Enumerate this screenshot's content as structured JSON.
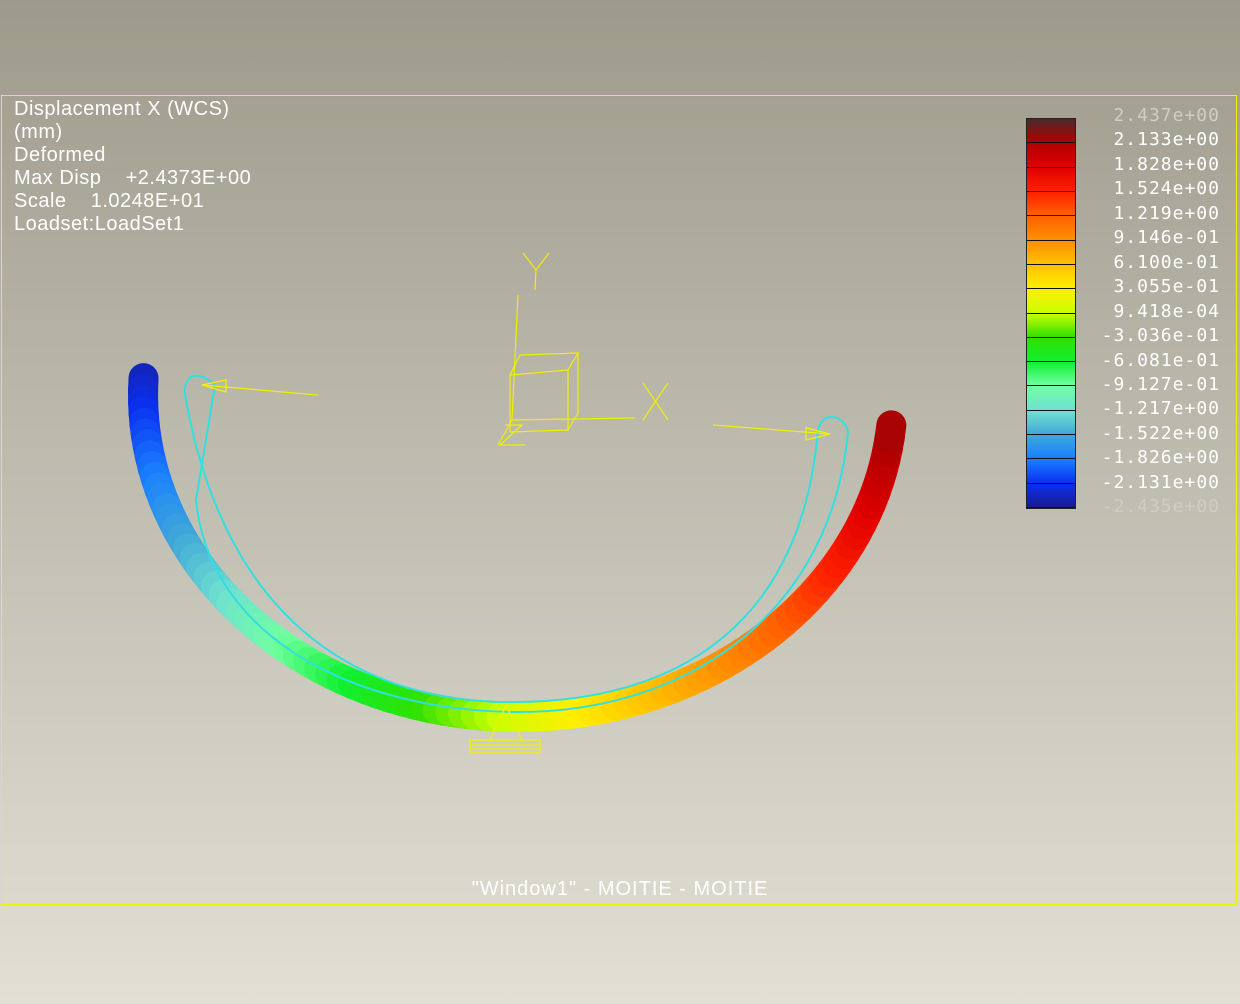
{
  "info": {
    "title": "Displacement X (WCS)",
    "units": "(mm)",
    "mode": "Deformed",
    "max_disp": "Max Disp    +2.4373E+00",
    "scale": "Scale    1.0248E+01",
    "loadset": "Loadset:LoadSet1"
  },
  "legend": {
    "labels": [
      "2.437e+00",
      "2.133e+00",
      "1.828e+00",
      "1.524e+00",
      "1.219e+00",
      "9.146e-01",
      "6.100e-01",
      "3.055e-01",
      "9.418e-04",
      "-3.036e-01",
      "-6.081e-01",
      "-9.127e-01",
      "-1.217e+00",
      "-1.522e+00",
      "-1.826e+00",
      "-2.131e+00",
      "-2.435e+00"
    ],
    "colors": [
      "#4a2a2a",
      "#b00000",
      "#e00000",
      "#ff2000",
      "#ff6000",
      "#ff9000",
      "#ffc000",
      "#ffee00",
      "#c8ff00",
      "#30e000",
      "#10f030",
      "#70ffa0",
      "#70e0d0",
      "#40a8d8",
      "#1a80ff",
      "#0a30f0",
      "#1a1a90"
    ]
  },
  "axes": {
    "x": "X",
    "y": "Y"
  },
  "footer": "\"Window1\" - MOITIE - MOITIE"
}
